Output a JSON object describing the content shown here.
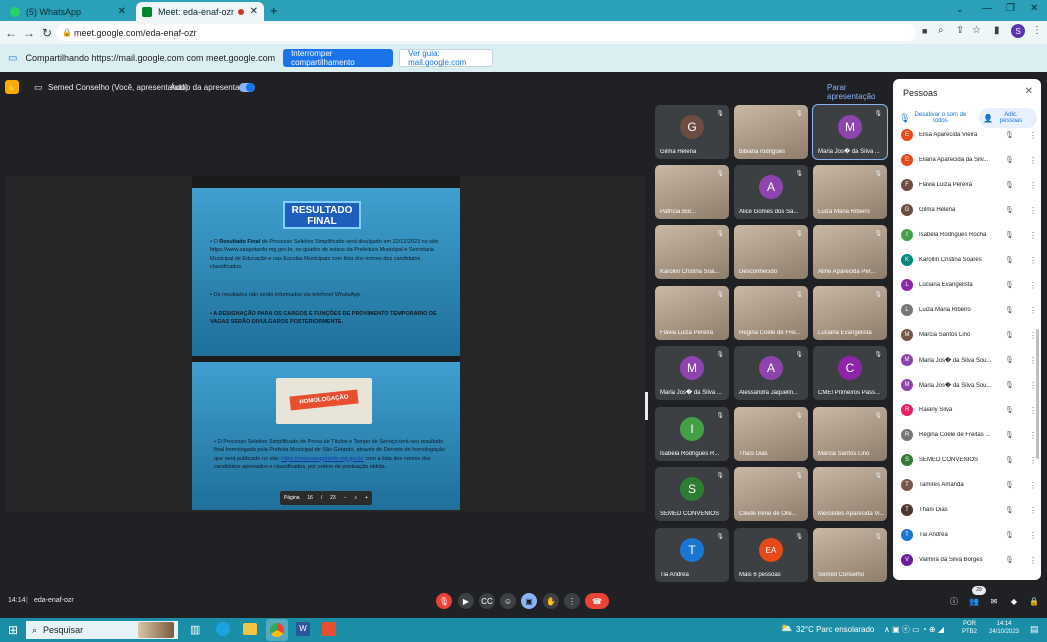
{
  "browser": {
    "tabs": [
      {
        "title": "(5) WhatsApp",
        "color": "#25d366"
      },
      {
        "title": "Meet: eda-enaf-ozr",
        "color": "#00832d",
        "active": true
      }
    ],
    "new_tab": "+",
    "url": "meet.google.com/eda-enaf-ozr"
  },
  "sharebar": {
    "text": "Compartilhando https://mail.google.com com meet.google.com",
    "stop_button": "Interromper compartilhamento",
    "view_button": "Ver guia: mail.google.com"
  },
  "presentation_bar": {
    "presenter": "Semed Conselho (Você, apresentando)",
    "audio_label": "Áudio da apresentação",
    "stop_button": "Parar apresentação"
  },
  "slides": {
    "s1_banner": "RESULTADO FINAL",
    "s1_bullet1_pre": "O ",
    "s1_bullet1_bold": "Resultado Final",
    "s1_bullet1_post": " do Processo Seletivo Simplificado será divulgado em 22/12/2023 no site: https://www.saogotardo.mg.gov.br, no quadro de avisos da Prefeitura Municipal e Secretaria Municipal de Educação e nas Escolas Municipais com lista dos nomes dos candidatos classificados.",
    "s1_bullet2": "Os resultados não serão informados via telefone/ WhatsApp.",
    "s1_bullet3": "A DESIGNAÇÃO PARA OS CARGOS E FUNÇÕES DE PROVIMENTO TEMPORÁRIO DE VAGAS SERÃO DIVULGADOS POSTERIORMENTE.",
    "s2_banner": "HOMOLOGAÇÃO",
    "s2_bullet_pre": "O Processo Seletivo Simplificado de Prova de Títulos e Tempo de Serviço terá seu resultado final homologado pela Prefeita Municipal de São Gotardo, através de Decreto de homologação que será publicado no site: ",
    "s2_link": "https://www.saogotardo.mg.gov.br",
    "s2_bullet_post": " com a lista dos nomes dos candidatos aprovados e classificados, por ordem de pontuação obtida.",
    "page_label": "Página",
    "page_current": "16",
    "page_sep": "/",
    "page_total": "23",
    "zoom_out": "−",
    "zoom_in": "+"
  },
  "tiles": [
    {
      "name": "Gilma Helena",
      "initial": "G",
      "color": "#6d4c41",
      "photo": false
    },
    {
      "name": "bibiana rodrigues",
      "initial": "",
      "color": "",
      "photo": true
    },
    {
      "name": "Maria Jos� da Silva ...",
      "initial": "M",
      "color": "#8e44ad",
      "photo": false
    },
    {
      "name": "Patrícia Bor...",
      "initial": "",
      "color": "",
      "photo": true
    },
    {
      "name": "Alice Gomes dos Sa...",
      "initial": "A",
      "color": "#8e44ad",
      "photo": false
    },
    {
      "name": "Luiza Maria Ribeiro",
      "initial": "",
      "color": "",
      "photo": true
    },
    {
      "name": "Karollin Cristina Soa...",
      "initial": "",
      "color": "",
      "photo": true
    },
    {
      "name": "Desconhecido",
      "initial": "",
      "color": "",
      "photo": true
    },
    {
      "name": "Aline Aparecida Per...",
      "initial": "",
      "color": "",
      "photo": true
    },
    {
      "name": "Flávia Luiza Pereira",
      "initial": "",
      "color": "",
      "photo": true
    },
    {
      "name": "Regina Coele de Frei...",
      "initial": "",
      "color": "",
      "photo": true
    },
    {
      "name": "Luciana Evangelista",
      "initial": "",
      "color": "",
      "photo": true
    },
    {
      "name": "Maria Jos� da Silva ...",
      "initial": "M",
      "color": "#8e44ad",
      "photo": false
    },
    {
      "name": "Alessandra Jaquelin...",
      "initial": "A",
      "color": "#8e44ad",
      "photo": false
    },
    {
      "name": "CMEI Primeiros Pass...",
      "initial": "C",
      "color": "#8e24aa",
      "photo": false
    },
    {
      "name": "Isabela Rodrigues R...",
      "initial": "I",
      "color": "#43a047",
      "photo": false
    },
    {
      "name": "Thaís Dias",
      "initial": "",
      "color": "",
      "photo": true
    },
    {
      "name": "Márcia Santos Lino",
      "initial": "",
      "color": "",
      "photo": true
    },
    {
      "name": "SEMED CONVÊNIOS",
      "initial": "S",
      "color": "#2e7d32",
      "photo": false
    },
    {
      "name": "Cleide Irene de Oliv...",
      "initial": "",
      "color": "",
      "photo": true
    },
    {
      "name": "Mercedes Aparecida Vi...",
      "initial": "",
      "color": "",
      "photo": true
    },
    {
      "name": "Tia Andrea",
      "initial": "T",
      "color": "#1976d2",
      "photo": false
    },
    {
      "name": "Mais 6 pessoas",
      "initial": "EA",
      "color": "#e64a19",
      "photo": false
    },
    {
      "name": "Semed Conselho",
      "initial": "",
      "color": "",
      "photo": true
    }
  ],
  "people_panel": {
    "title": "Pessoas",
    "mute_all": "Desativar o som de todos",
    "add_people": "Adic. pessoas",
    "list": [
      {
        "name": "Elisa Aparecida Vieira",
        "initial": "E",
        "color": "#e64a19"
      },
      {
        "name": "Eliana Aparecida da Silv...",
        "initial": "E",
        "color": "#e64a19"
      },
      {
        "name": "Flávia Luiza Pereira",
        "initial": "F",
        "color": "#6d4c41"
      },
      {
        "name": "Gilma Helena",
        "initial": "G",
        "color": "#6d4c41"
      },
      {
        "name": "Isabela Rodrigues Rocha",
        "initial": "I",
        "color": "#43a047"
      },
      {
        "name": "Karollin Cristina Soares",
        "initial": "K",
        "color": "#00897b"
      },
      {
        "name": "Luciana Evangelista",
        "initial": "L",
        "color": "#8e24aa"
      },
      {
        "name": "Luiza Maria Ribeiro",
        "initial": "L",
        "color": "#757575"
      },
      {
        "name": "Marcia Santos Lino",
        "initial": "M",
        "color": "#795548"
      },
      {
        "name": "Maria Jos� da Silva Sou...",
        "initial": "M",
        "color": "#8e44ad"
      },
      {
        "name": "Maria Jos� da Silva Sou...",
        "initial": "M",
        "color": "#8e44ad"
      },
      {
        "name": "Raiany Silva",
        "initial": "R",
        "color": "#e91e63"
      },
      {
        "name": "Regina Coele de Freitas ...",
        "initial": "R",
        "color": "#757575"
      },
      {
        "name": "SEMED CONVÊNIOS",
        "initial": "S",
        "color": "#2e7d32"
      },
      {
        "name": "Tamires Amanda",
        "initial": "T",
        "color": "#795548"
      },
      {
        "name": "Thaís Dias",
        "initial": "T",
        "color": "#4e342e"
      },
      {
        "name": "Tia Andrea",
        "initial": "T",
        "color": "#1976d2"
      },
      {
        "name": "Valmira da Silva Borges",
        "initial": "V",
        "color": "#6a1b9a"
      }
    ]
  },
  "bottom": {
    "time": "14:14",
    "separator": "|",
    "meeting_code": "eda-enaf-ozr",
    "participant_count": "29"
  },
  "taskbar": {
    "search": "Pesquisar",
    "weather": "32°C  Parc ensolarado",
    "lang_top": "POR",
    "lang_bottom": "PTB2",
    "clock_time": "14:14",
    "clock_date": "24/10/2023"
  }
}
